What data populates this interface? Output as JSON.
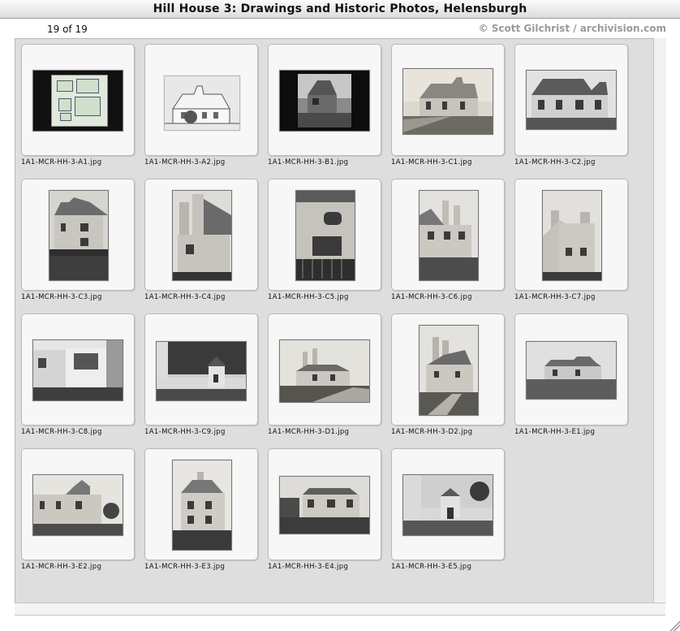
{
  "window": {
    "title": "Hill House 3: Drawings and Historic Photos, Helensburgh"
  },
  "info": {
    "count": "19 of 19",
    "credit": "© Scott Gilchrist / archivision.com"
  },
  "thumbnails": [
    {
      "caption": "1A1-MCR-HH-3-A1.jpg"
    },
    {
      "caption": "1A1-MCR-HH-3-A2.jpg"
    },
    {
      "caption": "1A1-MCR-HH-3-B1.jpg"
    },
    {
      "caption": "1A1-MCR-HH-3-C1.jpg"
    },
    {
      "caption": "1A1-MCR-HH-3-C2.jpg"
    },
    {
      "caption": "1A1-MCR-HH-3-C3.jpg"
    },
    {
      "caption": "1A1-MCR-HH-3-C4.jpg"
    },
    {
      "caption": "1A1-MCR-HH-3-C5.jpg"
    },
    {
      "caption": "1A1-MCR-HH-3-C6.jpg"
    },
    {
      "caption": "1A1-MCR-HH-3-C7.jpg"
    },
    {
      "caption": "1A1-MCR-HH-3-C8.jpg"
    },
    {
      "caption": "1A1-MCR-HH-3-C9.jpg"
    },
    {
      "caption": "1A1-MCR-HH-3-D1.jpg"
    },
    {
      "caption": "1A1-MCR-HH-3-D2.jpg"
    },
    {
      "caption": "1A1-MCR-HH-3-E1.jpg"
    },
    {
      "caption": "1A1-MCR-HH-3-E2.jpg"
    },
    {
      "caption": "1A1-MCR-HH-3-E3.jpg"
    },
    {
      "caption": "1A1-MCR-HH-3-E4.jpg"
    },
    {
      "caption": "1A1-MCR-HH-3-E5.jpg"
    }
  ]
}
